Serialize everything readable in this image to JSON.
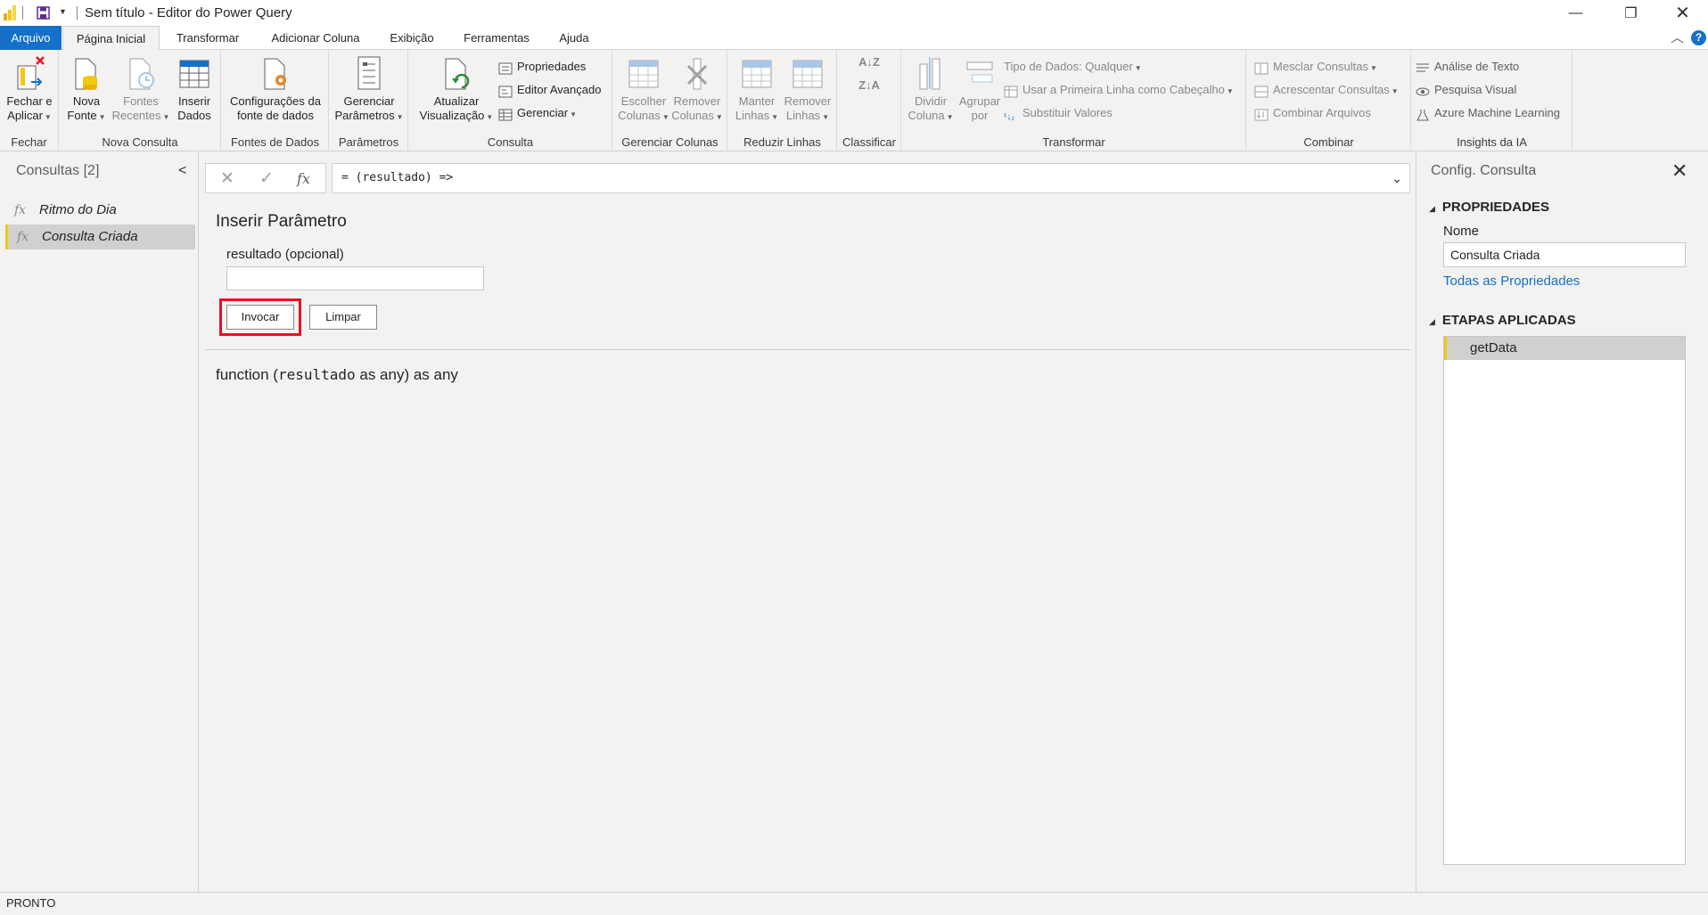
{
  "window": {
    "title": "Sem título - Editor do Power Query"
  },
  "tabs": [
    {
      "label": "Arquivo"
    },
    {
      "label": "Página Inicial"
    },
    {
      "label": "Transformar"
    },
    {
      "label": "Adicionar Coluna"
    },
    {
      "label": "Exibição"
    },
    {
      "label": "Ferramentas"
    },
    {
      "label": "Ajuda"
    }
  ],
  "ribbon": {
    "fechar": {
      "label": "Fechar",
      "btn1": "Fechar e",
      "btn2": "Aplicar"
    },
    "nova_consulta": {
      "label": "Nova Consulta",
      "nova1": "Nova",
      "nova2": "Fonte",
      "recentes1": "Fontes",
      "recentes2": "Recentes",
      "inserir1": "Inserir",
      "inserir2": "Dados"
    },
    "fontes": {
      "label": "Fontes de Dados",
      "btn1": "Configurações da",
      "btn2": "fonte de dados"
    },
    "parametros": {
      "label": "Parâmetros",
      "btn1": "Gerenciar",
      "btn2": "Parâmetros"
    },
    "consulta": {
      "label": "Consulta",
      "atualizar1": "Atualizar",
      "atualizar2": "Visualização",
      "propriedades": "Propriedades",
      "editor": "Editor Avançado",
      "gerenciar": "Gerenciar"
    },
    "gerenciar_colunas": {
      "label": "Gerenciar Colunas",
      "escolher1": "Escolher",
      "escolher2": "Colunas",
      "remover1": "Remover",
      "remover2": "Colunas"
    },
    "reduzir": {
      "label": "Reduzir Linhas",
      "manter1": "Manter",
      "manter2": "Linhas",
      "remover1": "Remover",
      "remover2": "Linhas"
    },
    "classificar": {
      "label": "Classificar"
    },
    "transformar": {
      "label": "Transformar",
      "dividir1": "Dividir",
      "dividir2": "Coluna",
      "agrupar1": "Agrupar",
      "agrupar2": "por",
      "tipo": "Tipo de Dados: Qualquer",
      "primeira": "Usar a Primeira Linha como Cabeçalho",
      "substituir": "Substituir Valores"
    },
    "combinar": {
      "label": "Combinar",
      "mesclar": "Mesclar Consultas",
      "acrescentar": "Acrescentar Consultas",
      "combinar_arq": "Combinar Arquivos"
    },
    "ia": {
      "label": "Insights da IA",
      "texto": "Análise de Texto",
      "visual": "Pesquisa Visual",
      "azure": "Azure Machine Learning"
    }
  },
  "queries": {
    "header": "Consultas [2]",
    "items": [
      {
        "label": "Ritmo do Dia"
      },
      {
        "label": "Consulta Criada"
      }
    ]
  },
  "formula_bar": {
    "formula": "= (resultado) =>"
  },
  "invoke": {
    "title": "Inserir Parâmetro",
    "param_label": "resultado (opcional)",
    "param_value": "",
    "invoke_label": "Invocar",
    "clear_label": "Limpar",
    "sig_prefix": "function (",
    "sig_param": "resultado",
    "sig_suffix": " as any) as any"
  },
  "settings": {
    "title": "Config. Consulta",
    "props_header": "PROPRIEDADES",
    "name_label": "Nome",
    "name_value": "Consulta Criada",
    "all_props": "Todas as Propriedades",
    "steps_header": "ETAPAS APLICADAS",
    "steps": [
      {
        "label": "getData"
      }
    ]
  },
  "status": {
    "text": "PRONTO"
  },
  "colors": {
    "accent": "#1570c9",
    "highlight": "#e81123",
    "selection_bar": "#f2c811"
  }
}
